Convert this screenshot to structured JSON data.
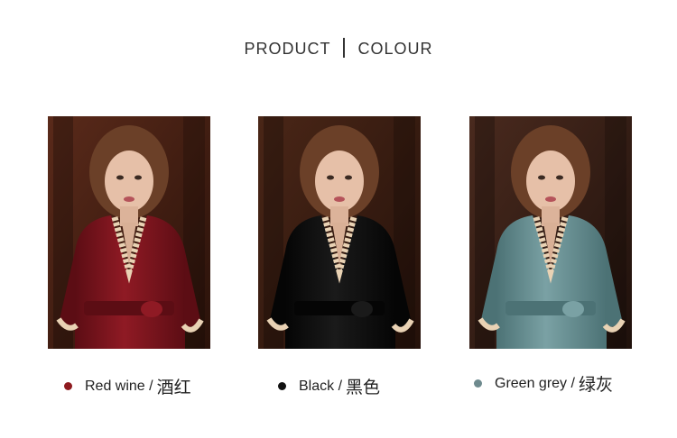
{
  "header": {
    "left": "PRODUCT",
    "right": "COLOUR"
  },
  "colors": [
    {
      "en": "Red wine /",
      "cn": "酒红",
      "swatch": "#8e1b1f",
      "robe": "#8f1a24",
      "robe_dark": "#5c0d14",
      "bg": "#5a2a1a",
      "bg_dark": "#2a120a"
    },
    {
      "en": "Black /",
      "cn": "黑色",
      "swatch": "#111111",
      "robe": "#1a1a1a",
      "robe_dark": "#050505",
      "bg": "#4a2617",
      "bg_dark": "#24110a"
    },
    {
      "en": "Green grey /",
      "cn": "绿灰",
      "swatch": "#6e8a8e",
      "robe": "#7aa1a4",
      "robe_dark": "#4c7275",
      "bg": "#4a2a1e",
      "bg_dark": "#1f110c"
    }
  ]
}
